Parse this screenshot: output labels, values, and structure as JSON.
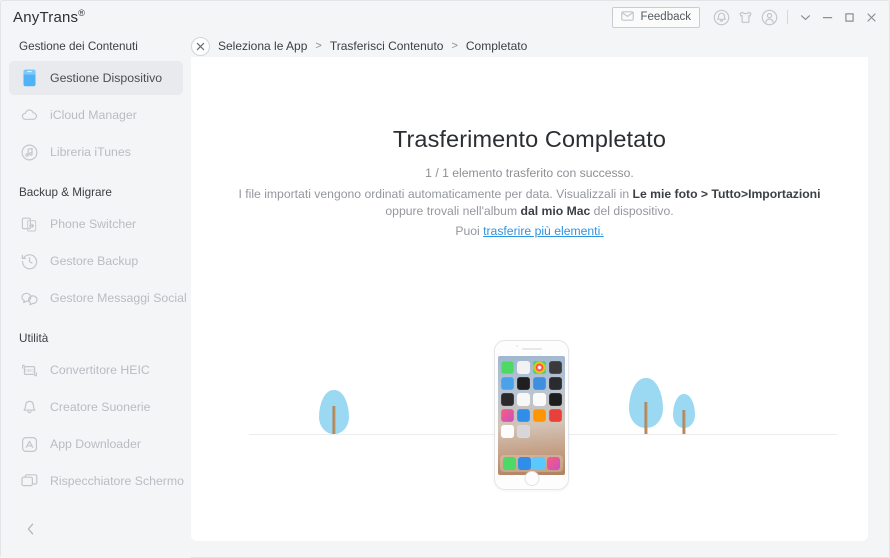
{
  "app": {
    "brand": "AnyTrans",
    "brand_mark": "®"
  },
  "titlebar": {
    "feedback_label": "Feedback",
    "icons": {
      "mail": "mail-icon",
      "bell": "bell-icon",
      "shirt": "shirt-icon",
      "account": "account-icon",
      "chevron_down": "chevron-down-icon",
      "minimize": "minimize-icon",
      "maximize": "maximize-icon",
      "close": "close-icon"
    }
  },
  "sidebar": {
    "groups": [
      {
        "title": "Gestione dei Contenuti",
        "items": [
          {
            "label": "Gestione Dispositivo",
            "icon": "device-icon",
            "active": true
          },
          {
            "label": "iCloud Manager",
            "icon": "cloud-icon",
            "active": false
          },
          {
            "label": "Libreria iTunes",
            "icon": "music-note-icon",
            "active": false
          }
        ]
      },
      {
        "title": "Backup & Migrare",
        "items": [
          {
            "label": "Phone Switcher",
            "icon": "phone-switch-icon",
            "active": false
          },
          {
            "label": "Gestore Backup",
            "icon": "clock-history-icon",
            "active": false
          },
          {
            "label": "Gestore Messaggi Social",
            "icon": "chat-bubbles-icon",
            "active": false
          }
        ]
      },
      {
        "title": "Utilità",
        "items": [
          {
            "label": "Convertitore HEIC",
            "icon": "heic-convert-icon",
            "active": false
          },
          {
            "label": "Creatore Suonerie",
            "icon": "bell-outline-icon",
            "active": false
          },
          {
            "label": "App Downloader",
            "icon": "appstore-icon",
            "active": false
          },
          {
            "label": "Rispecchiatore Schermo",
            "icon": "screen-mirror-icon",
            "active": false
          }
        ]
      }
    ],
    "collapse_icon": "chevron-left-icon"
  },
  "breadcrumb": {
    "close_icon": "close-x-icon",
    "separator": ">",
    "steps": [
      "Seleziona le App",
      "Trasferisci Contenuto",
      "Completato"
    ]
  },
  "main": {
    "headline": "Trasferimento Completato",
    "subline": "1 / 1 elemento trasferito con successo.",
    "description": {
      "part1": "I file importati vengono ordinati automaticamente per data. Visualizzali in ",
      "bold1": "Le mie foto > Tutto>Importazioni",
      "part2": " oppure trovali nell'album ",
      "bold2": "dal mio Mac",
      "part3": " del dispositivo."
    },
    "more": {
      "prefix": "Puoi ",
      "link": "trasferire più elementi."
    },
    "illustration": {
      "device": "iphone-illustration",
      "trees": "tree-illustration",
      "ground": "ground-line"
    }
  },
  "colors": {
    "accent_link": "#2f93e0",
    "active_icon_blue": "#3fa9f5",
    "tree_blue": "#9bd9f2",
    "sidebar_bg": "#f4f5f7",
    "card_bg": "#ffffff",
    "muted_text": "#b9bcc1"
  }
}
